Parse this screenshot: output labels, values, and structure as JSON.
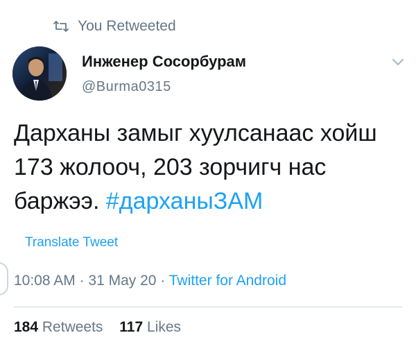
{
  "retweet_context": {
    "icon": "retweet-icon",
    "label": "You Retweeted"
  },
  "author": {
    "display_name": "Инженер Сосорбурам",
    "handle": "@Burma0315",
    "avatar": "avatar"
  },
  "menu": {
    "icon": "chevron-down-icon"
  },
  "tweet": {
    "text": "Дарханы замыг хуулсанаас хойш  173 жолооч, 203 зорчигч нас баржээ. ",
    "hashtag": "#дарханыЗАМ"
  },
  "translate_label": "Translate Tweet",
  "meta": {
    "time": "10:08 AM",
    "separator": " · ",
    "date": "31 May 20",
    "source": "Twitter for Android"
  },
  "stats": {
    "retweets_count": "184",
    "retweets_label": "Retweets",
    "likes_count": "117",
    "likes_label": "Likes"
  },
  "colors": {
    "accent": "#1da1f2",
    "secondary_text": "#657786",
    "primary_text": "#14171a",
    "divider": "#ccd6dd"
  }
}
